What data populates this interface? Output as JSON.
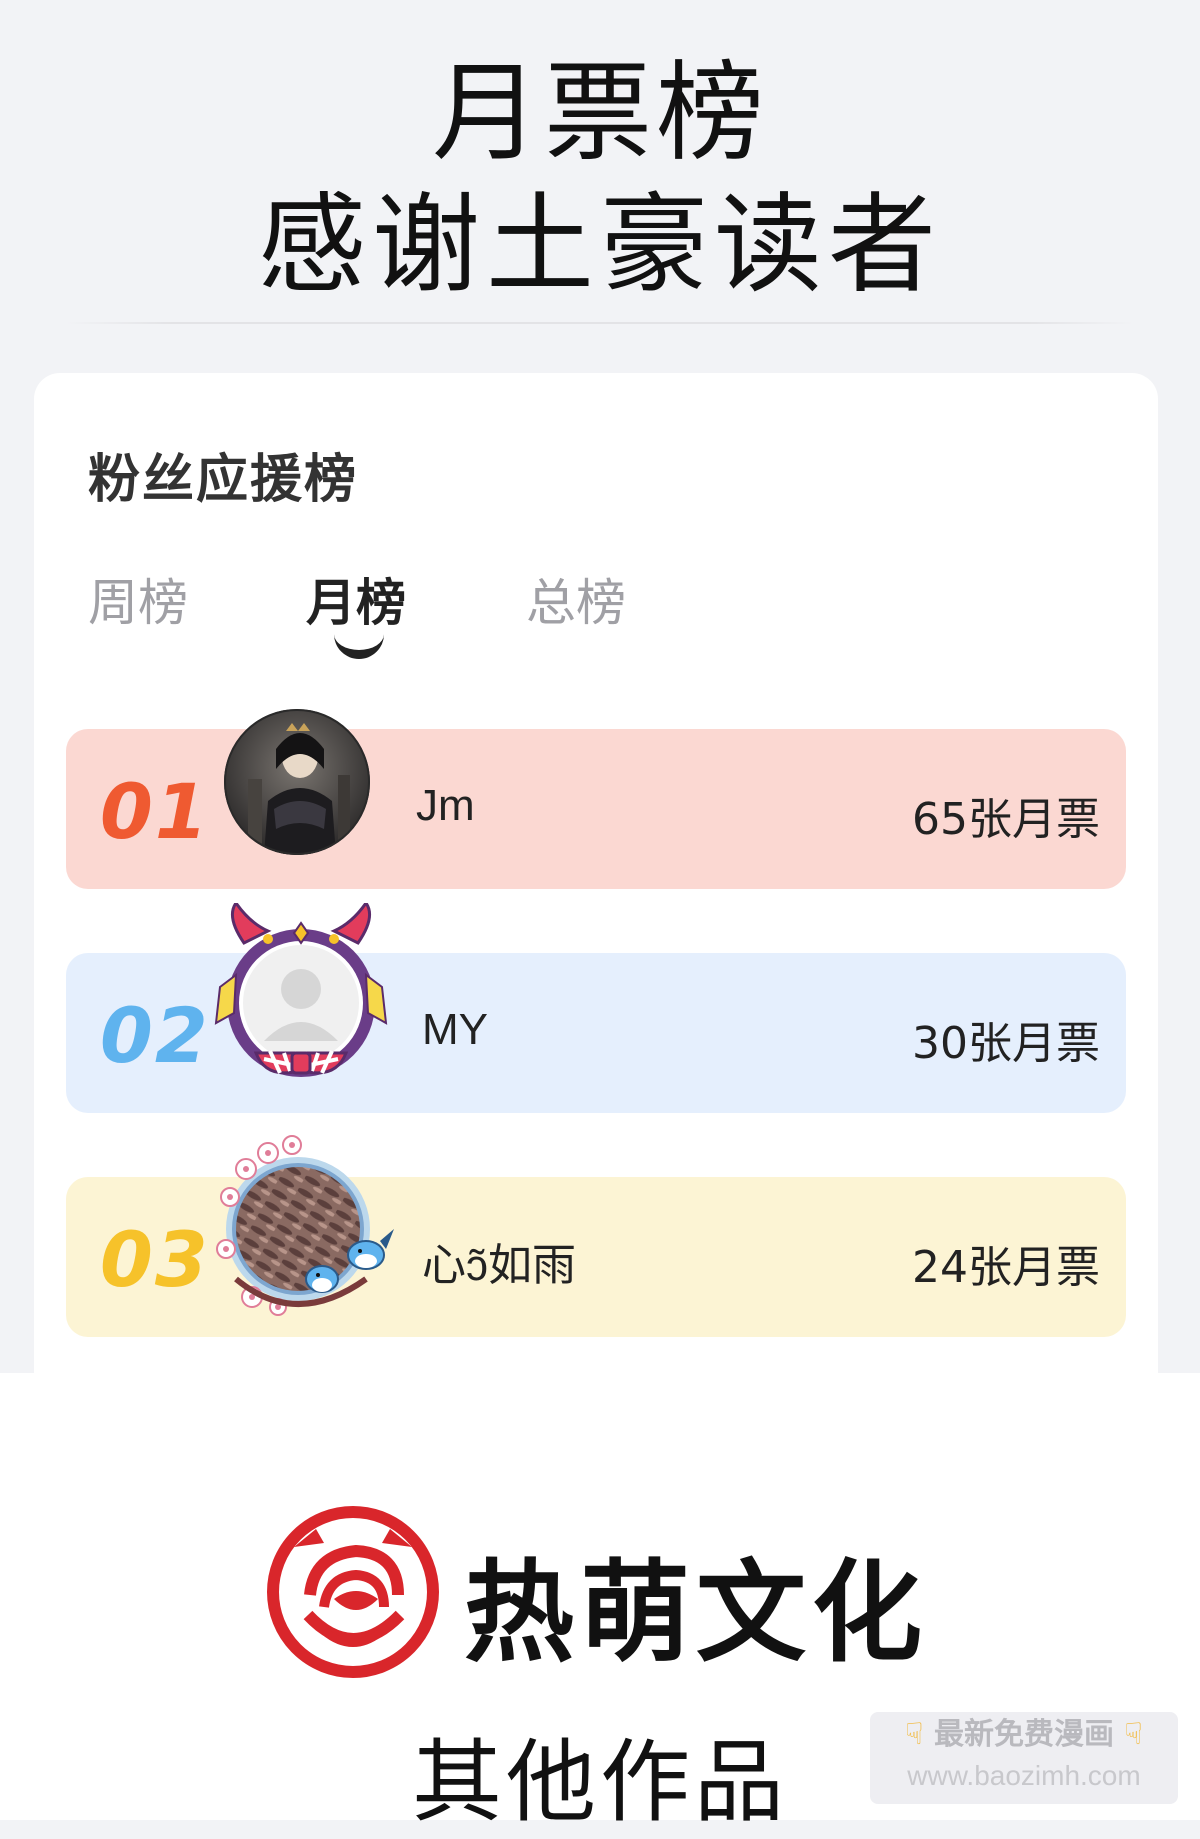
{
  "header": {
    "title_line1": "月票榜",
    "title_line2": "感谢土豪读者"
  },
  "card": {
    "title": "粉丝应援榜",
    "tabs": [
      {
        "label": "周榜",
        "active": false
      },
      {
        "label": "月榜",
        "active": true
      },
      {
        "label": "总榜",
        "active": false
      }
    ],
    "ranks": [
      {
        "rank": "01",
        "name": "Jm",
        "tickets": "65张月票",
        "color": "#ef5a31",
        "bg": "#fbd8d2"
      },
      {
        "rank": "02",
        "name": "MY",
        "tickets": "30张月票",
        "color": "#5fb3ee",
        "bg": "#e5effd"
      },
      {
        "rank": "03",
        "name": "心ɔ̃如雨",
        "tickets": "24张月票",
        "color": "#f6c22a",
        "bg": "#fcf4d4"
      }
    ]
  },
  "footer": {
    "brand_name": "热萌文化",
    "brand_color": "#d9262b",
    "other_works": "其他作品"
  },
  "watermark": {
    "line1": "最新免费漫画",
    "line2": "www.baozimh.com"
  }
}
